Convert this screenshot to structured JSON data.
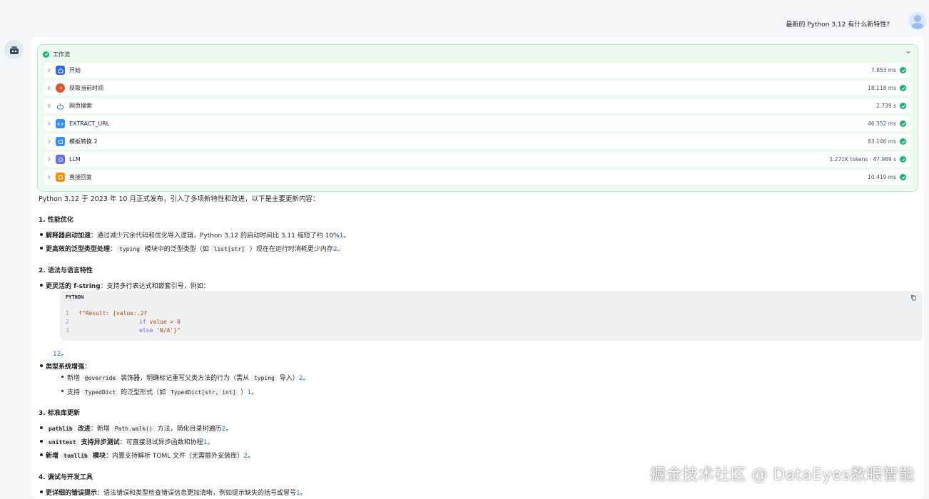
{
  "user_message": "最新的 Python 3.12 有什么新特性?",
  "workflow": {
    "title": "工作流",
    "nodes": [
      {
        "label": "开始",
        "time": "7.853 ms",
        "icon": "home-icon",
        "color": "#2e6bf0"
      },
      {
        "label": "获取当前时间",
        "time": "18.118 ms",
        "icon": "clock-icon",
        "color": "#e5532d"
      },
      {
        "label": "网页搜索",
        "time": "2.739 s",
        "icon": "robot-icon",
        "color": "#ffffff"
      },
      {
        "label": "EXTRACT_URL",
        "time": "46.352 ms",
        "icon": "code-icon",
        "color": "#2e90fa"
      },
      {
        "label": "模板转换 2",
        "time": "83.146 ms",
        "icon": "template-icon",
        "color": "#2e90fa"
      },
      {
        "label": "LLM",
        "time": "1.271K tokens · 47.989 s",
        "icon": "llm-icon",
        "color": "#6172f3"
      },
      {
        "label": "直接回复",
        "time": "10.419 ms",
        "icon": "reply-icon",
        "color": "#f79009"
      }
    ]
  },
  "content": {
    "intro": "Python 3.12 于 2023 年 10 月正式发布，引入了多项新特性和改进，以下是主要更新内容：",
    "s1": {
      "heading": "1. 性能优化",
      "i1_b": "解释器启动加速",
      "i1_t": "：通过减少冗余代码和优化导入逻辑，Python 3.12 的启动时间比 3.11 缩短了约 10%",
      "i1_c": "1",
      "i1_end": "。",
      "i2_b": "更高效的泛型类型处理",
      "i2_t1": "：",
      "i2_code1": "typing",
      "i2_t2": " 模块中的泛型类型（如 ",
      "i2_code2": "list[str]",
      "i2_t3": " ）现在在运行时消耗更少内存",
      "i2_c": "2",
      "i2_end": "。"
    },
    "s2": {
      "heading": "2. 语法与语言特性",
      "i1_b": "更灵活的 f-string",
      "i1_t": "：支持多行表达式和嵌套引号，例如：",
      "code_lang": "PYTHON",
      "code_l1": "f\"Result: {value:.2f",
      "code_l2_kw": "if",
      "code_l2_rest": " value > ",
      "code_l2_num": "0",
      "code_l3_kw": "else",
      "code_l3_rest": " 'N/A'}\"",
      "after_code": "12",
      "after_code_end": "。",
      "i2_b": "类型系统增强",
      "i2_t": "：",
      "sub1_t1": "新增 ",
      "sub1_code": "@override",
      "sub1_t2": " 装饰器，明确标记重写父类方法的行为（需从 ",
      "sub1_code2": "typing",
      "sub1_t3": " 导入）",
      "sub1_c": "2",
      "sub1_end": "。",
      "sub2_t1": "支持 ",
      "sub2_code": "TypedDict",
      "sub2_t2": " 的泛型形式（如 ",
      "sub2_code2": "TypedDict[str, int]",
      "sub2_t3": " ）",
      "sub2_c": "1",
      "sub2_end": "。"
    },
    "s3": {
      "heading": "3. 标准库更新",
      "i1_code": "pathlib",
      "i1_b": " 改进",
      "i1_t1": "：新增 ",
      "i1_code2": "Path.walk()",
      "i1_t2": " 方法，简化目录树遍历",
      "i1_c": "2",
      "i1_end": "。",
      "i2_code": "unittest",
      "i2_b": " 支持异步测试",
      "i2_t": "：可直接测试异步函数和协程",
      "i2_c": "1",
      "i2_end": "。",
      "i3_b1": "新增 ",
      "i3_code": "tomllib",
      "i3_b2": " 模块",
      "i3_t": "：内置支持解析 TOML 文件（无需额外安装库）",
      "i3_c": "2",
      "i3_end": "。"
    },
    "s4": {
      "heading": "4. 调试与开发工具",
      "i1_b": "更详细的错误提示",
      "i1_t": "：语法错误和类型检查错误信息更加清晰，例如提示缺失的括号或冒号",
      "i1_c": "1",
      "i1_end": "。"
    }
  },
  "watermark": "掘金技术社区 @ DataEyes数眼智能"
}
